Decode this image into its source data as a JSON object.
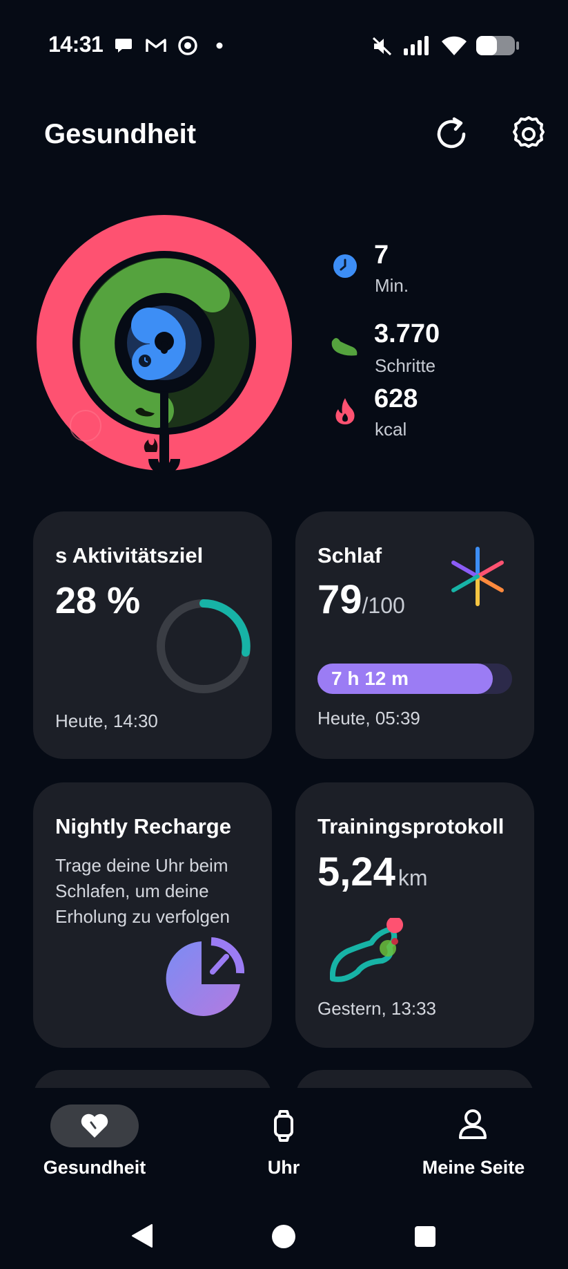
{
  "status_bar": {
    "time": "14:31"
  },
  "header": {
    "title": "Gesundheit"
  },
  "activity": {
    "minutes_value": "7",
    "minutes_label": "Min.",
    "steps_value": "3.770",
    "steps_label": "Schritte",
    "kcal_value": "628",
    "kcal_label": "kcal",
    "colors": {
      "minutes": "#3d8ef5",
      "steps": "#55a33e",
      "kcal": "#fe5271"
    }
  },
  "cards": {
    "goal": {
      "title": "s Aktivitätsziel",
      "value": "28 %",
      "progress": 0.28,
      "footer": "Heute, 14:30"
    },
    "sleep": {
      "title": "Schlaf",
      "score": "79",
      "score_max": "/100",
      "duration": "7 h 12 m",
      "footer": "Heute, 05:39"
    },
    "recharge": {
      "title": "Nightly Recharge",
      "text": "Trage deine Uhr beim Schlafen, um deine Erholung zu verfolgen"
    },
    "training": {
      "title": "Trainingsprotokoll",
      "value": "5,24",
      "unit": "km",
      "footer": "Gestern, 13:33"
    }
  },
  "nav": {
    "items": [
      {
        "label": "Gesundheit",
        "icon": "heart-icon",
        "active": true
      },
      {
        "label": "Uhr",
        "icon": "watch-icon",
        "active": false
      },
      {
        "label": "Meine Seite",
        "icon": "person-icon",
        "active": false
      }
    ]
  }
}
